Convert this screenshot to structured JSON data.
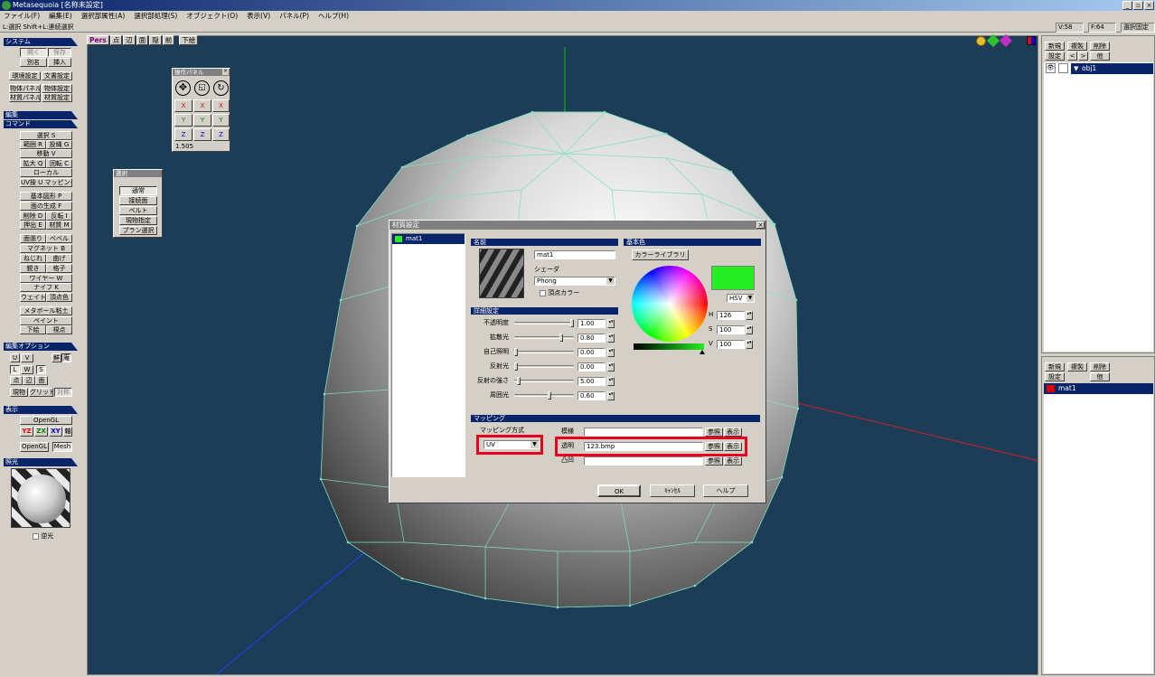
{
  "window": {
    "title": "Metasequoia [名称未設定]"
  },
  "menu": [
    "ファイル(F)",
    "編集(E)",
    "選択部属性(A)",
    "選択部処理(S)",
    "オブジェクト(O)",
    "表示(V)",
    "パネル(P)",
    "ヘルプ(H)"
  ],
  "hint": "L:選択  Shift+L:連続選択",
  "status": {
    "v": "V:58",
    "f": "F:64",
    "mode": "選択固定"
  },
  "left": {
    "system": {
      "title": "システム",
      "open": "開く",
      "save": "保存",
      "saveas": "別名",
      "insert": "挿入",
      "env": "環境設定",
      "doc": "文書設定",
      "objpanel": "物体パネル",
      "objsettings": "物体設定",
      "matpanel": "材質パネル",
      "matsettings": "材質設定"
    },
    "edit": {
      "title": "編集"
    },
    "command": {
      "title": "コマンド",
      "select": "選択 S",
      "range": "範囲 R",
      "lasso": "投縄 G",
      "move": "移動 V",
      "scale": "拡大 Q",
      "rotate": "回転 C",
      "local": "ローカル",
      "uv": "UV操 U マッピング",
      "basic": "基本図形 P",
      "face": "面の生成 F",
      "delete": "削除 D",
      "flip": "反転 I",
      "extrude": "押出 E",
      "material": "材質 M",
      "knife": "面張り",
      "bevel": "ベベル",
      "magnet": "マグネット B",
      "twist": "ねじれ",
      "bend": "曲げ",
      "sharpen": "鋭き",
      "grid": "格子",
      "wire": "ワイヤー W",
      "knife2": "ナイフ K",
      "weight": "ウェイト",
      "vcolor": "頂点色",
      "metaball": "メタボール粘土",
      "paint": "ペイント",
      "underlay": "下絵",
      "viewpt": "視点"
    },
    "editopt": {
      "title": "編集オプション",
      "u": "U",
      "v": "V",
      "tri": "鮮",
      "quad": "庵",
      "l": "L",
      "w": "W",
      "s": "S",
      "pt": "点",
      "edge": "辺",
      "face": "面",
      "current": "現物",
      "grid": "グリッド",
      "snap": "対称"
    },
    "display": {
      "title": "表示",
      "opengl": "OpenGL",
      "yz": "YZ",
      "zx": "ZX",
      "xy": "XY",
      "axis": "軸",
      "opengl2": "OpenGL",
      "mesh": "Mesh"
    },
    "lighting": {
      "title": "照光",
      "backlight": "逆光"
    }
  },
  "viewport": {
    "tabs": [
      "Pers",
      "点",
      "辺",
      "面",
      "隠",
      "前",
      "下絵"
    ],
    "colors": {
      "bg": "#1c3c58",
      "wire": "#7fe0c0"
    }
  },
  "opPanel": {
    "title": "操作パネル",
    "x": "X",
    "y": "Y",
    "z": "Z",
    "value": "1.505"
  },
  "selPanel": {
    "title": "選択",
    "items": [
      "通常",
      "接続面",
      "ベルト",
      "現物指定",
      "プラン選択"
    ]
  },
  "dialog": {
    "title": "材質設定",
    "material": {
      "name": "mat1",
      "color": "#22ee22"
    },
    "nameSection": {
      "title": "名前",
      "value": "mat1",
      "shaderLabel": "シェーダ",
      "shader": "Phong",
      "vcolor": "頂点カラー"
    },
    "detail": {
      "title": "詳細設定",
      "rows": [
        {
          "label": "不透明度",
          "value": "1.00",
          "pos": 1.0
        },
        {
          "label": "拡散光",
          "value": "0.80",
          "pos": 0.8
        },
        {
          "label": "自己照明",
          "value": "0.00",
          "pos": 0.0
        },
        {
          "label": "反射光",
          "value": "0.00",
          "pos": 0.0
        },
        {
          "label": "反射の強さ",
          "value": "5.00",
          "pos": 0.05
        },
        {
          "label": "周囲光",
          "value": "0.60",
          "pos": 0.6
        }
      ]
    },
    "base": {
      "title": "基本色",
      "library": "カラーライブラリ",
      "mode": "HSV",
      "h": "126",
      "s": "100",
      "v": "100",
      "hLabel": "H",
      "sLabel": "S",
      "vLabel": "V"
    },
    "mapping": {
      "title": "マッピング",
      "methodLabel": "マッピング方式",
      "method": "UV",
      "rows": [
        {
          "label": "模様",
          "value": "",
          "ref": "参照",
          "show": "表示"
        },
        {
          "label": "透明",
          "value": "123.bmp",
          "ref": "参照",
          "show": "表示"
        },
        {
          "label": "凸凹",
          "value": "",
          "ref": "参照",
          "show": "表示"
        }
      ]
    },
    "ok": "OK",
    "cancel": "ｷｬﾝｾﾙ",
    "help": "ヘルプ"
  },
  "objectPanel": {
    "new": "新規",
    "copy": "複製",
    "delete": "削除",
    "settings": "設定",
    "prev": "<",
    "next": ">",
    "other": "他",
    "item": "obj1"
  },
  "materialPanel": {
    "new": "新規",
    "copy": "複製",
    "delete": "削除",
    "settings": "設定",
    "other": "他",
    "item": "mat1",
    "color": "#dd0000"
  }
}
